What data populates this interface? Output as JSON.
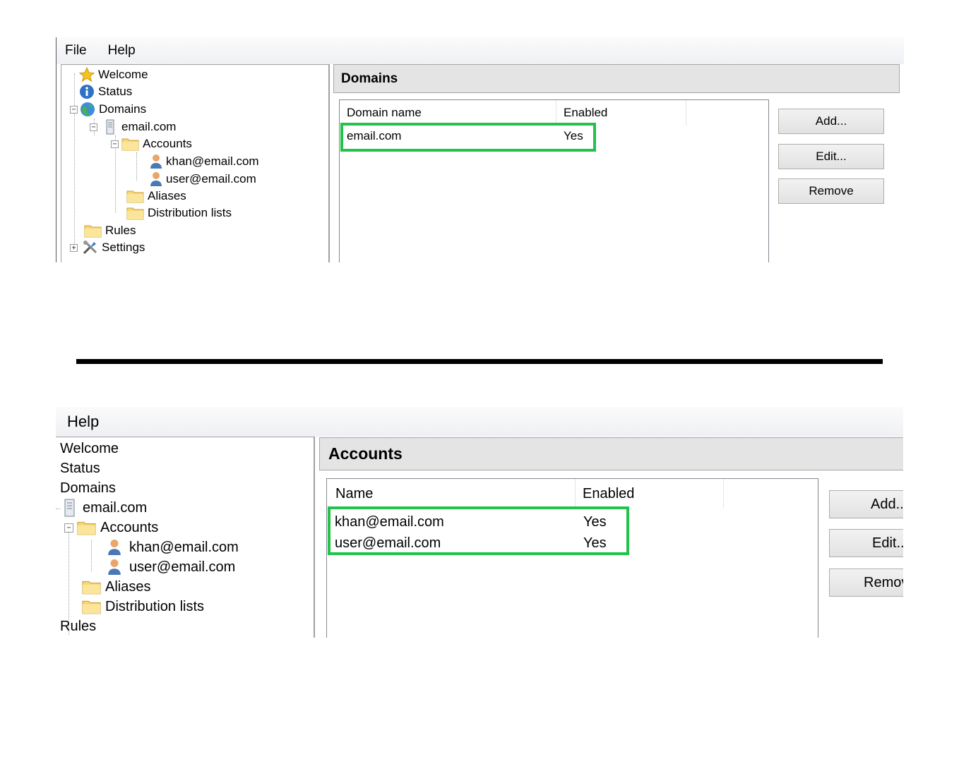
{
  "top": {
    "menu": [
      "File",
      "Help"
    ],
    "tree": [
      "Welcome",
      "Status",
      "Domains",
      "email.com",
      "Accounts",
      "khan@email.com",
      "user@email.com",
      "Aliases",
      "Distribution lists",
      "Rules",
      "Settings"
    ],
    "panel_title": "Domains",
    "columns": [
      "Domain name",
      "Enabled"
    ],
    "rows": [
      {
        "name": "email.com",
        "enabled": "Yes"
      }
    ],
    "buttons": [
      "Add...",
      "Edit...",
      "Remove"
    ]
  },
  "bottom": {
    "menu": [
      "Help"
    ],
    "tree": [
      "Welcome",
      "Status",
      "Domains",
      "email.com",
      "Accounts",
      "khan@email.com",
      "user@email.com",
      "Aliases",
      "Distribution lists",
      "Rules"
    ],
    "panel_title": "Accounts",
    "columns": [
      "Name",
      "Enabled"
    ],
    "rows": [
      {
        "name": "khan@email.com",
        "enabled": "Yes"
      },
      {
        "name": "user@email.com",
        "enabled": "Yes"
      }
    ],
    "buttons": [
      "Add...",
      "Edit...",
      "Remove"
    ]
  },
  "colors": {
    "highlight": "#22c34a",
    "separator": "#000000"
  }
}
